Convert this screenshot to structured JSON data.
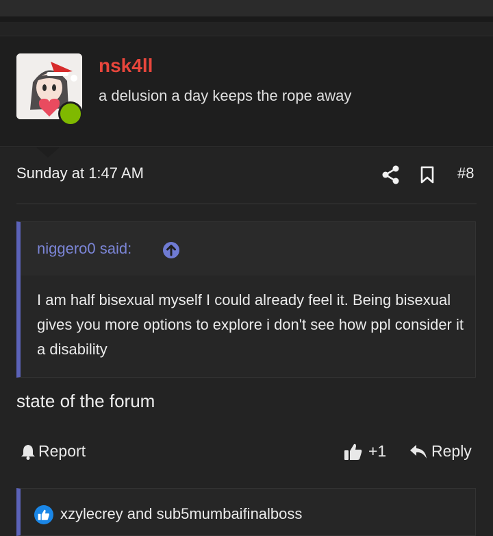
{
  "user": {
    "name": "nsk4ll",
    "title": "a delusion a day keeps the rope away",
    "online": true
  },
  "post": {
    "date": "Sunday at 1:47 AM",
    "number": "#8",
    "body": "state of the forum"
  },
  "quote": {
    "author": "niggero0 said:",
    "text": "I am half bisexual myself I could already feel it. Being bisexual gives you more options to explore i don't see how ppl consider it a disability"
  },
  "actions": {
    "report": "Report",
    "like_count": "+1",
    "reply": "Reply"
  },
  "reactions": {
    "text": "xzylecrey and sub5mumbaifinalboss"
  },
  "colors": {
    "background": "#232323",
    "username": "#e8463c",
    "quote_accent": "#5b62b8",
    "online_dot": "#7fb900",
    "reaction_badge": "#1a86e6"
  },
  "icons": [
    "share-icon",
    "bookmark-icon",
    "arrow-up-circle-icon",
    "bell-icon",
    "thumbs-up-icon",
    "reply-arrow-icon",
    "like-reaction-icon"
  ]
}
